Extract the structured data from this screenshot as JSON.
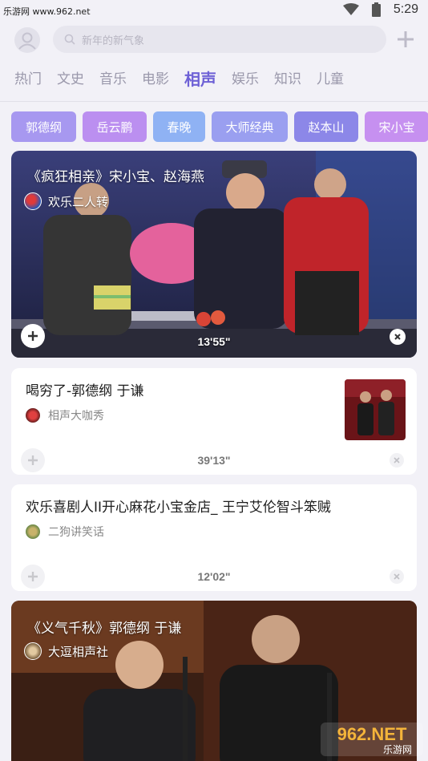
{
  "status_bar": {
    "site_watermark": "乐游网 www.962.net",
    "time": "5:29"
  },
  "search": {
    "placeholder": "新年的新气象"
  },
  "tabs": [
    {
      "label": "热门",
      "active": false
    },
    {
      "label": "文史",
      "active": false
    },
    {
      "label": "音乐",
      "active": false
    },
    {
      "label": "电影",
      "active": false
    },
    {
      "label": "相声",
      "active": true
    },
    {
      "label": "娱乐",
      "active": false
    },
    {
      "label": "知识",
      "active": false
    },
    {
      "label": "儿童",
      "active": false
    }
  ],
  "tags": [
    {
      "label": "郭德纲",
      "color": "#a798f0"
    },
    {
      "label": "岳云鹏",
      "color": "#bb8ff0"
    },
    {
      "label": "春晚",
      "color": "#8fb2f4"
    },
    {
      "label": "大师经典",
      "color": "#9a9ff0"
    },
    {
      "label": "赵本山",
      "color": "#8c87e8"
    },
    {
      "label": "宋小宝",
      "color": "#c690f0"
    }
  ],
  "feed": [
    {
      "title": "《疯狂相亲》宋小宝、赵海燕",
      "channel": "欢乐二人转",
      "duration": "13'55\""
    },
    {
      "title": "喝穷了-郭德纲 于谦",
      "channel": "相声大咖秀",
      "duration": "39'13\""
    },
    {
      "title": "欢乐喜剧人II开心麻花小宝金店_ 王宁艾伦智斗笨贼",
      "channel": "二狗讲笑话",
      "duration": "12'02\""
    },
    {
      "title": "《义气千秋》郭德纲 于谦",
      "channel": "大逗相声社"
    }
  ],
  "corner_logo": {
    "text": "962.NET",
    "subtext": "乐游网"
  },
  "colors": {
    "accent": "#6e61d6",
    "background": "#f2f1f7"
  }
}
